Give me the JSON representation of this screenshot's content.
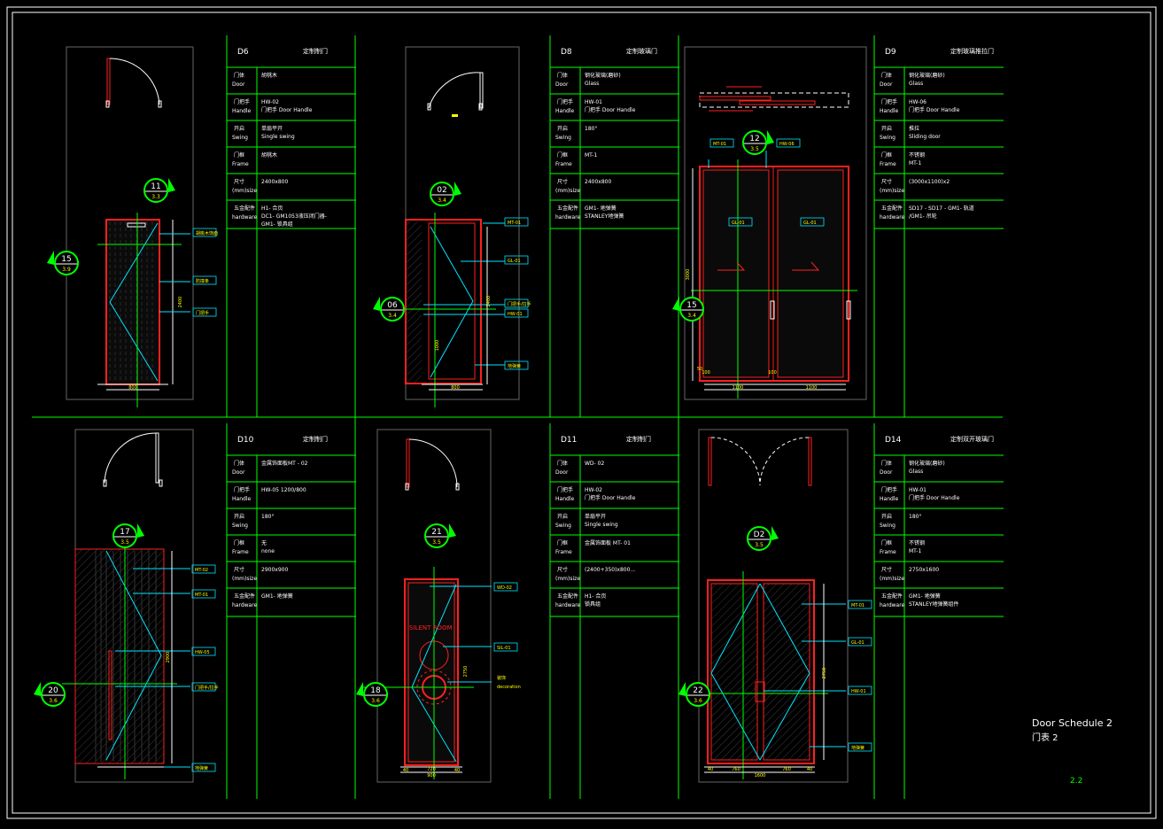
{
  "title_block": {
    "title_en": "Door Schedule 2",
    "title_cn": "门表 2",
    "page": "2.2"
  },
  "tables": [
    {
      "id": "D6",
      "title": "定制制门",
      "rows": [
        [
          "门体",
          "Door",
          "胡桃木"
        ],
        [
          "门把手",
          "Handle",
          "HW-02",
          "门把手 Door Handle"
        ],
        [
          "开启",
          "Swing",
          "单扇平开",
          "Single swing"
        ],
        [
          "门框",
          "Frame",
          "胡桃木"
        ],
        [
          "尺寸",
          "(mm)size",
          "2400x800"
        ],
        [
          "五金配件",
          "hardware",
          "H1- 合页",
          "DC1- GM1053液压闭门器-",
          "GM1- 锁具组"
        ]
      ]
    },
    {
      "id": "D8",
      "title": "定制玻璃门",
      "rows": [
        [
          "门体",
          "Door",
          "钢化玻璃(磨砂)",
          "Glass"
        ],
        [
          "门把手",
          "Handle",
          "HW-01",
          "门把手 Door Handle"
        ],
        [
          "开启",
          "Swing",
          "180°"
        ],
        [
          "门框",
          "Frame",
          "MT-1"
        ],
        [
          "尺寸",
          "(mm)size",
          "2400x800"
        ],
        [
          "五金配件",
          "hardware",
          "GM1- 地弹簧",
          "STANLEY地弹簧"
        ]
      ]
    },
    {
      "id": "D9",
      "title": "定制玻璃推拉门",
      "rows": [
        [
          "门体",
          "Door",
          "钢化玻璃(磨砂)",
          "Glass"
        ],
        [
          "门把手",
          "Handle",
          "HW-06",
          "门把手 Door Handle"
        ],
        [
          "开启",
          "Swing",
          "推拉",
          "Sliding door"
        ],
        [
          "门框",
          "Frame",
          "不锈钢",
          "MT-1"
        ],
        [
          "尺寸",
          "(mm)size",
          "(3000x1100)x2"
        ],
        [
          "五金配件",
          "hardware",
          "SD17 - SD17 - GM1- 轨道",
          "/GM1- 吊轮"
        ]
      ]
    },
    {
      "id": "D10",
      "title": "定制制门",
      "rows": [
        [
          "门体",
          "Door",
          "金属饰面板MT - 02"
        ],
        [
          "门把手",
          "Handle",
          "HW-05 1200/800"
        ],
        [
          "开启",
          "Swing",
          "180°"
        ],
        [
          "门框",
          "Frame",
          "无",
          "none"
        ],
        [
          "尺寸",
          "(mm)size",
          "2900x900"
        ],
        [
          "五金配件",
          "hardware",
          "GM1- 地弹簧"
        ]
      ]
    },
    {
      "id": "D11",
      "title": "定制制门",
      "rows": [
        [
          "门体",
          "Door",
          "WD- 02"
        ],
        [
          "门把手",
          "Handle",
          "HW-02",
          "门把手 Door Handle"
        ],
        [
          "开启",
          "Swing",
          "单扇平开",
          "Single swing"
        ],
        [
          "门框",
          "Frame",
          "金属饰面板 MT- 01"
        ],
        [
          "尺寸",
          "(mm)size",
          "(2400+350)x800..."
        ],
        [
          "五金配件",
          "hardware",
          "H1- 合页",
          "锁具组"
        ]
      ]
    },
    {
      "id": "D14",
      "title": "定制双开玻璃门",
      "rows": [
        [
          "门体",
          "Door",
          "钢化玻璃(磨砂)",
          "Glass"
        ],
        [
          "门把手",
          "Handle",
          "HW-01",
          "门把手 Door Handle"
        ],
        [
          "开启",
          "Swing",
          "180°"
        ],
        [
          "门框",
          "Frame",
          "不锈钢",
          "MT-1"
        ],
        [
          "尺寸",
          "(mm)size",
          "2750x1600"
        ],
        [
          "五金配件",
          "hardware",
          "GM1- 地弹簧",
          "STANLEY地弹簧组件"
        ]
      ]
    }
  ],
  "callouts": [
    {
      "num": "11",
      "sub": "3.3"
    },
    {
      "num": "15",
      "sub": "3.9"
    },
    {
      "num": "02",
      "sub": "3.4"
    },
    {
      "num": "06",
      "sub": "3.4"
    },
    {
      "num": "12",
      "sub": "3.5"
    },
    {
      "num": "15",
      "sub": "3.4"
    },
    {
      "num": "17",
      "sub": "3.5"
    },
    {
      "num": "20",
      "sub": "3.6"
    },
    {
      "num": "21",
      "sub": "3.5"
    },
    {
      "num": "18",
      "sub": "3.6"
    },
    {
      "num": "D2",
      "sub": "3.5"
    },
    {
      "num": "22",
      "sub": "3.6"
    }
  ],
  "tags": {
    "d6": [
      "胡桃木饰面",
      "防撞条",
      "门把手"
    ],
    "d8": [
      "MT-01",
      "GL-01",
      "门把手/拉手",
      "HW-01",
      "地弹簧"
    ],
    "d9": [
      "MT-01",
      "HW-06",
      "GL-01",
      "GL-01"
    ],
    "d10": [
      "MT-02",
      "MT-01",
      "HW-05",
      "门把手/拉手",
      "地弹簧"
    ],
    "d11": [
      "WD-02",
      "SIL-01",
      "装饰",
      "decoration",
      "SILENT ROOM"
    ],
    "d14": [
      "MT-01",
      "GL-01",
      "HW-01",
      "地弹簧"
    ]
  },
  "dims": {
    "d6": [
      "800",
      "2400"
    ],
    "d8": [
      "800",
      "2400",
      "1000"
    ],
    "d9": [
      "1100",
      "1100",
      "3000",
      "100",
      "100",
      "50"
    ],
    "d10": [
      "2900"
    ],
    "d11": [
      "720",
      "900",
      "2750",
      "40",
      "40"
    ],
    "d14": [
      "1600",
      "760",
      "760",
      "2750",
      "40",
      "40"
    ]
  },
  "colors": {
    "bg": "#000000",
    "frame": "#ffffff",
    "green": "#00ff00",
    "red": "#ff2020",
    "cyan": "#00e5ff",
    "yellow": "#ffff00",
    "white": "#ffffff"
  }
}
